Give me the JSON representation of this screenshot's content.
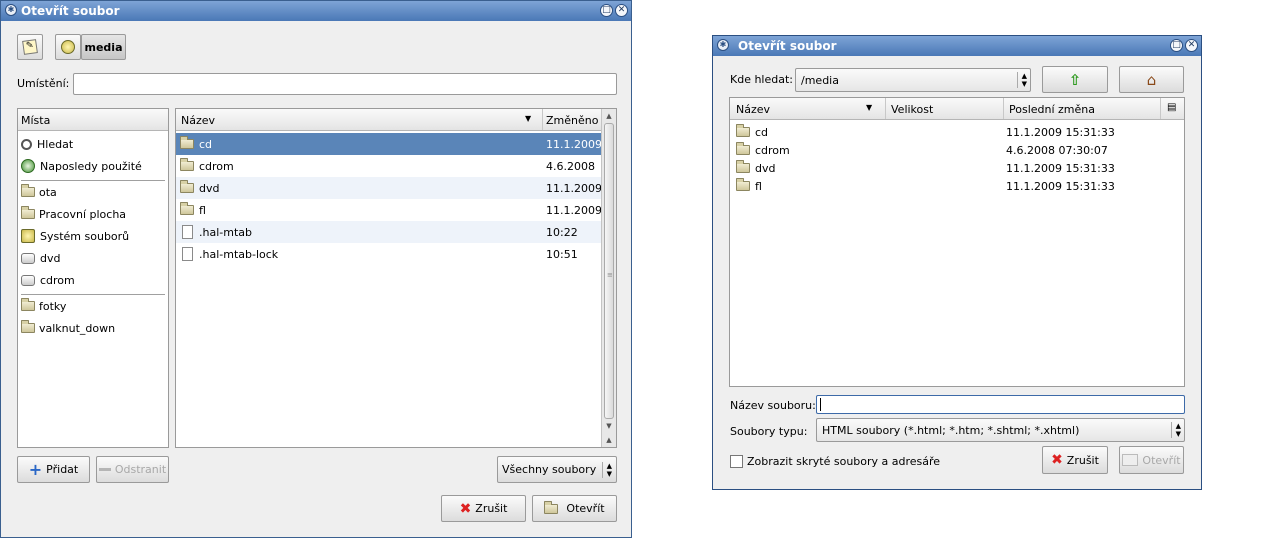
{
  "left": {
    "title": "Otevřít soubor",
    "path_button": "media",
    "location_label": "Umístění:",
    "location_value": "",
    "places_header": "Místa",
    "places": [
      {
        "label": "Hledat",
        "icon": "search-icon"
      },
      {
        "label": "Naposledy použité",
        "icon": "recent-icon"
      },
      {
        "label": "ota",
        "icon": "folder-icon"
      },
      {
        "label": "Pracovní plocha",
        "icon": "folder-icon"
      },
      {
        "label": "Systém souborů",
        "icon": "drive-icon"
      },
      {
        "label": "dvd",
        "icon": "disc-icon"
      },
      {
        "label": "cdrom",
        "icon": "disc-icon"
      },
      {
        "label": "fotky",
        "icon": "folder-icon"
      },
      {
        "label": "valknut_down",
        "icon": "folder-icon"
      }
    ],
    "columns": {
      "name": "Název",
      "modified": "Změněno"
    },
    "files": [
      {
        "name": "cd",
        "modified": "11.1.2009",
        "type": "folder",
        "selected": true
      },
      {
        "name": "cdrom",
        "modified": "4.6.2008",
        "type": "folder",
        "selected": false
      },
      {
        "name": "dvd",
        "modified": "11.1.2009",
        "type": "folder",
        "selected": false
      },
      {
        "name": "fl",
        "modified": "11.1.2009",
        "type": "folder",
        "selected": false
      },
      {
        "name": ".hal-mtab",
        "modified": "10:22",
        "type": "file",
        "selected": false
      },
      {
        "name": ".hal-mtab-lock",
        "modified": "10:51",
        "type": "file",
        "selected": false
      }
    ],
    "add_label": "Přidat",
    "remove_label": "Odstranit",
    "filter_label": "Všechny soubory",
    "cancel_label": "Zrušit",
    "open_label": "Otevřít"
  },
  "right": {
    "title": "Otevřít soubor",
    "look_in_label": "Kde hledat:",
    "look_in_value": "/media",
    "columns": {
      "name": "Název",
      "size": "Velikost",
      "modified": "Poslední změna"
    },
    "files": [
      {
        "name": "cd",
        "modified": "11.1.2009 15:31:33"
      },
      {
        "name": "cdrom",
        "modified": "4.6.2008 07:30:07"
      },
      {
        "name": "dvd",
        "modified": "11.1.2009 15:31:33"
      },
      {
        "name": "fl",
        "modified": "11.1.2009 15:31:33"
      }
    ],
    "filename_label": "Název souboru:",
    "filename_value": "",
    "filetype_label": "Soubory typu:",
    "filetype_value": "HTML soubory (*.html; *.htm; *.shtml; *.xhtml)",
    "show_hidden_label": "Zobrazit skryté soubory a adresáře",
    "cancel_label": "Zrušit",
    "open_label": "Otevřít"
  },
  "colors": {
    "selection": "#5a85b8",
    "alt_row": "#eef3fa",
    "title_bar": "#4a78b6"
  }
}
